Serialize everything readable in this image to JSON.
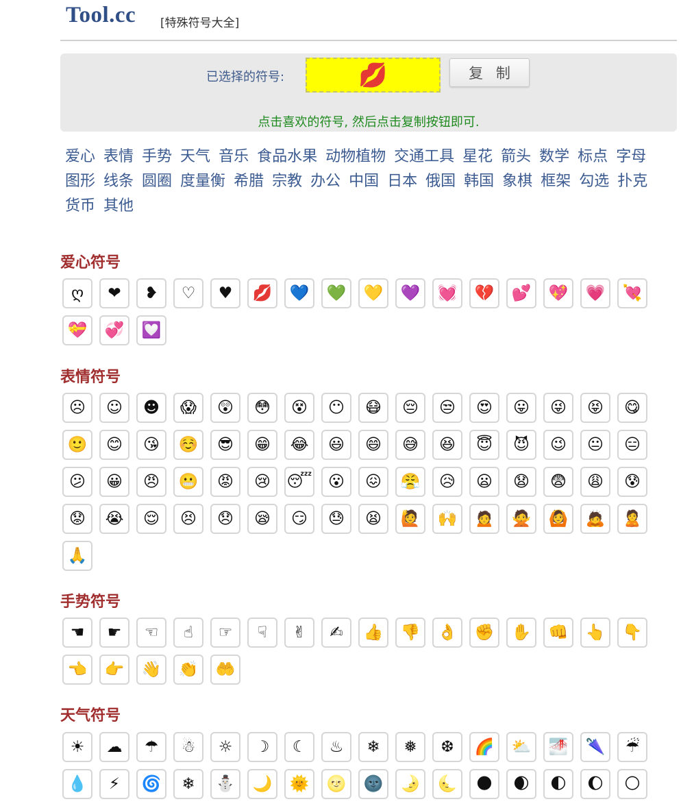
{
  "header": {
    "logo": "Tool.cc",
    "subtitle": "[特殊符号大全]"
  },
  "selection": {
    "label": "已选择的符号:",
    "selected_symbol": "💋",
    "copy_label": "复 制",
    "hint": "点击喜欢的符号, 然后点击复制按钮即可."
  },
  "categories": [
    "爱心",
    "表情",
    "手势",
    "天气",
    "音乐",
    "食品水果",
    "动物植物",
    "交通工具",
    "星花",
    "箭头",
    "数学",
    "标点",
    "字母",
    "图形",
    "线条",
    "圆圈",
    "度量衡",
    "希腊",
    "宗教",
    "办公",
    "中国",
    "日本",
    "俄国",
    "韩国",
    "象棋",
    "框架",
    "勾选",
    "扑克",
    "货币",
    "其他"
  ],
  "sections": {
    "hearts": {
      "title": "爱心符号",
      "symbols": [
        "ღ",
        "❤",
        "❥",
        "♡",
        "♥",
        "💋",
        "💙",
        "💚",
        "💛",
        "💜",
        "💓",
        "💔",
        "💕",
        "💖",
        "💗",
        "💘",
        "💝",
        "💞",
        "💟"
      ]
    },
    "faces": {
      "title": "表情符号",
      "symbols": [
        "☹",
        "☺",
        "☻",
        "😱",
        "😲",
        "😳",
        "😵",
        "😶",
        "😷",
        "😔",
        "😒",
        "😍",
        "😛",
        "😜",
        "😝",
        "😋",
        "🙂",
        "😊",
        "😘",
        "☺️",
        "😎",
        "😁",
        "😂",
        "😃",
        "😄",
        "😅",
        "😆",
        "😇",
        "😈",
        "😉",
        "😐",
        "😑",
        "😕",
        "😀",
        "😠",
        "😬",
        "😡",
        "😢",
        "😴",
        "😮",
        "😖",
        "😤",
        "😥",
        "😦",
        "😧",
        "😨",
        "😩",
        "😰",
        "😟",
        "😭",
        "😌",
        "😣",
        "😞",
        "😪",
        "😏",
        "😓",
        "😫",
        "🙋",
        "🙌",
        "🙍",
        "🙅",
        "🙆",
        "🙇",
        "🙎",
        "🙏"
      ]
    },
    "gestures": {
      "title": "手势符号",
      "symbols": [
        "☚",
        "☛",
        "☜",
        "☝",
        "☞",
        "☟",
        "✌",
        "✍",
        "👍",
        "👎",
        "👌",
        "✊",
        "✋",
        "👊",
        "👆",
        "👇",
        "👈",
        "👉",
        "👋",
        "👏",
        "🤲"
      ]
    },
    "weather": {
      "title": "天气符号",
      "symbols": [
        "☀",
        "☁",
        "☂",
        "☃",
        "☼",
        "☽",
        "☾",
        "♨",
        "❄",
        "❅",
        "❆",
        "🌈",
        "⛅",
        "🌁",
        "🌂",
        "☔",
        "💧",
        "⚡",
        "🌀",
        "❄",
        "⛄",
        "🌙",
        "🌞",
        "🌝",
        "🌚",
        "🌛",
        "🌜",
        "🌑",
        "🌒",
        "🌓",
        "🌔",
        "🌕"
      ]
    }
  },
  "colors": {
    "logo": "#2f4f86",
    "link": "#3c5b91",
    "section_title": "#a12e2e",
    "hint": "#1f8a1f",
    "selected_bg": "#ffff00",
    "panel_bg": "#e9e9e9"
  }
}
